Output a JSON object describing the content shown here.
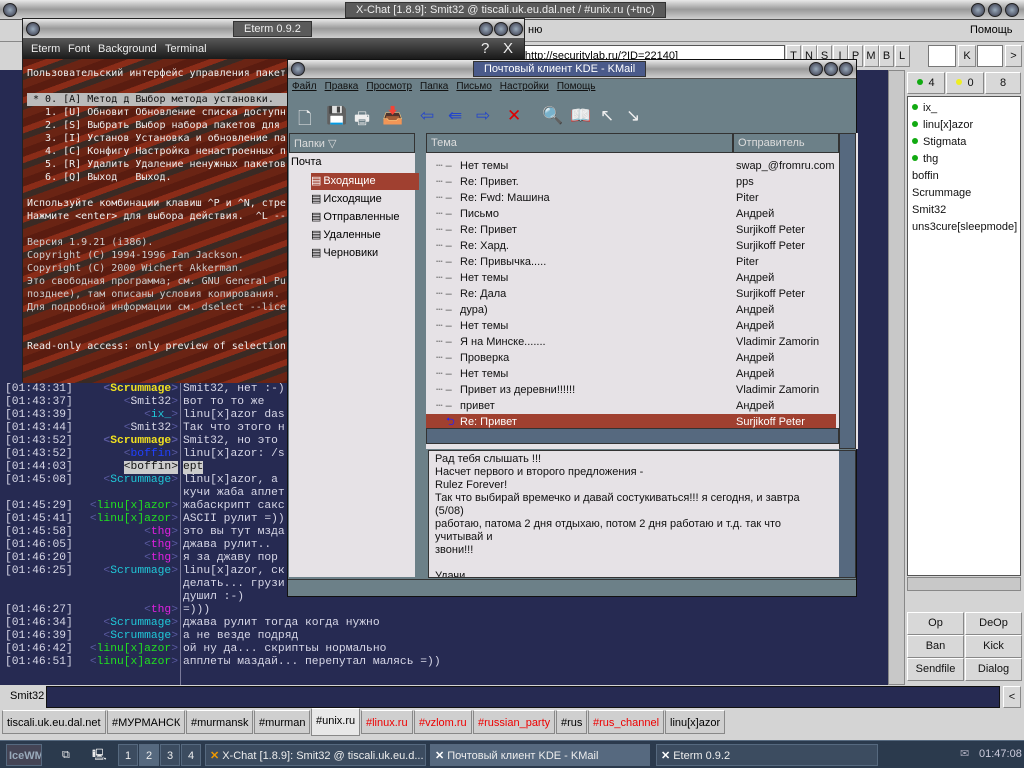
{
  "xchat": {
    "title": "X-Chat [1.8.9]: Smit32 @ tiscali.uk.eu.dal.net / #unix.ru (+tnc)",
    "menu_partial": "ню",
    "menu_help": "Помощь",
    "topic": "ru [http://securitylab.ru/?ID=22140]",
    "mode_buttons": [
      "T",
      "N",
      "S",
      "I",
      "P",
      "M",
      "B",
      "L"
    ],
    "key_label": "K",
    "next": ">",
    "prev": "<",
    "chat": [
      {
        "time": "[01:43:31]",
        "nick": "Scrummage",
        "color": "#f0e020",
        "bold": true,
        "text": [
          "Smit32, нет :-)"
        ]
      },
      {
        "time": "[01:43:37]",
        "nick": "Smit32",
        "color": "#d8d8e8",
        "text": [
          "вот то то же"
        ]
      },
      {
        "time": "[01:43:39]",
        "nick": "ix_",
        "color": "#20c8d8",
        "text": [
          "linu[x]azor das"
        ]
      },
      {
        "time": "[01:43:44]",
        "nick": "Smit32",
        "color": "#d8d8e8",
        "text": [
          "Так что этого н"
        ]
      },
      {
        "time": "[01:43:52]",
        "nick": "Scrummage",
        "color": "#f0e020",
        "bold": true,
        "text": [
          "Smit32, но это"
        ]
      },
      {
        "time": "[01:43:52]",
        "nick": "boffin",
        "color": "#2040ff",
        "text": [
          "linu[x]azor: /s"
        ]
      },
      {
        "time": "[01:44:03]",
        "nick": "boffin",
        "color": "#111",
        "hl": true,
        "text": [
          "ept"
        ]
      },
      {
        "time": "[01:45:08]",
        "nick": "Scrummage",
        "color": "#20c8d8",
        "text": [
          "linu[x]azor, а",
          "кучи жаба аплет"
        ]
      },
      {
        "time": "[01:45:29]",
        "nick": "linu[x]azor",
        "color": "#20e020",
        "text": [
          "жабаскрипт сакс"
        ]
      },
      {
        "time": "[01:45:41]",
        "nick": "linu[x]azor",
        "color": "#20e020",
        "text": [
          "ASCII рулит =))"
        ]
      },
      {
        "time": "[01:45:58]",
        "nick": "thg",
        "color": "#e020e0",
        "text": [
          "это вы тут мзда"
        ]
      },
      {
        "time": "[01:46:05]",
        "nick": "thg",
        "color": "#e020e0",
        "text": [
          "джава рулит.."
        ]
      },
      {
        "time": "[01:46:20]",
        "nick": "thg",
        "color": "#e020e0",
        "text": [
          "я за джаву пор"
        ]
      },
      {
        "time": "[01:46:25]",
        "nick": "Scrummage",
        "color": "#20c8d8",
        "text": [
          "linu[x]azor, ск",
          "делать... грузи",
          "душил :-)"
        ]
      },
      {
        "time": "[01:46:27]",
        "nick": "thg",
        "color": "#e020e0",
        "text": [
          "=)))"
        ]
      },
      {
        "time": "[01:46:34]",
        "nick": "Scrummage",
        "color": "#20c8d8",
        "text": [
          "джава рулит тогда когда нужно"
        ]
      },
      {
        "time": "[01:46:39]",
        "nick": "Scrummage",
        "color": "#20c8d8",
        "text": [
          "а не везде подряд"
        ]
      },
      {
        "time": "[01:46:42]",
        "nick": "linu[x]azor",
        "color": "#20e020",
        "text": [
          "ой ну да... скриптьы нормально"
        ]
      },
      {
        "time": "[01:46:51]",
        "nick": "linu[x]azor",
        "color": "#20e020",
        "text": [
          "апплеты маздай... перепутал малясь =))"
        ]
      }
    ],
    "counts": {
      "ops": "4",
      "voices": "0",
      "total": "8"
    },
    "users": [
      {
        "name": "ix_",
        "op": true
      },
      {
        "name": "linu[x]azor",
        "op": true
      },
      {
        "name": "Stigmata",
        "op": true
      },
      {
        "name": "thg",
        "op": true
      },
      {
        "name": "boffin"
      },
      {
        "name": "Scrummage"
      },
      {
        "name": "Smit32"
      },
      {
        "name": "uns3cure[sleepmode]"
      }
    ],
    "user_buttons": [
      "Op",
      "DeOp",
      "Ban",
      "Kick",
      "Sendfile",
      "Dialog"
    ],
    "nick": "Smit32",
    "tabs": [
      {
        "label": "tiscali.uk.eu.dal.net"
      },
      {
        "label": "#МУРМАНСК"
      },
      {
        "label": "#murmansk"
      },
      {
        "label": "#murman"
      },
      {
        "label": "#unix.ru",
        "active": true
      },
      {
        "label": "#linux.ru",
        "red": true
      },
      {
        "label": "#vzlom.ru",
        "red": true
      },
      {
        "label": "#russian_party",
        "red": true
      },
      {
        "label": "#rus"
      },
      {
        "label": "#rus_channel",
        "red": true
      },
      {
        "label": "linu[x]azor"
      }
    ]
  },
  "eterm": {
    "title": "Eterm 0.9.2",
    "menu": [
      "Eterm",
      "Font",
      "Background",
      "Terminal"
    ],
    "help": "?",
    "close": "X",
    "lines": [
      "Пользовательский интерфейс управления пакет",
      "",
      " * 0. [A] Метод д Выбор метода установки.",
      "   1. [U] Обновит Обновление списка доступн",
      "   2. [S] Выбрать Выбор набора пакетов для",
      "   3. [I] Установ Установка и обновление па",
      "   4. [C] Конфигу Настройка ненастроенных п",
      "   5. [R] Удалить Удаление ненужных пакетов",
      "   6. [Q] Выход   Выход.",
      "",
      "Используйте комбинации клавиш ^P и ^N, стре",
      "Нажмите <enter> для выбора действия.  ^L --",
      "",
      "Версия 1.9.21 (i386).",
      "Copyright (C) 1994-1996 Ian Jackson.",
      "Copyright (C) 2000 Wichert Akkerman.",
      "Это свободная программа; см. GNU General Pu",
      "позднее), там описаны условия копирования.",
      "Для подробной информации см. dselect --lice",
      "",
      "",
      "Read-only access: only preview of selection"
    ]
  },
  "kmail": {
    "title": "Почтовый клиент KDE - KMail",
    "menu": [
      "Файл",
      "Правка",
      "Просмотр",
      "Папка",
      "Письмо",
      "Настройки",
      "Помощь"
    ],
    "toolbar": [
      "new-message-icon",
      "save-icon",
      "print-icon",
      "check-mail-icon",
      "reply-icon",
      "reply-all-icon",
      "forward-icon",
      "delete-icon",
      "search-icon",
      "address-book-icon",
      "previous-icon",
      "next-icon"
    ],
    "folders_header": "Папки",
    "root": "Почта",
    "folders": [
      {
        "name": "Входящие",
        "icon": "inbox-icon",
        "selected": true
      },
      {
        "name": "Исходящие",
        "icon": "outbox-icon"
      },
      {
        "name": "Отправленные",
        "icon": "sent-icon"
      },
      {
        "name": "Удаленные",
        "icon": "trash-icon"
      },
      {
        "name": "Черновики",
        "icon": "drafts-icon"
      }
    ],
    "col_subject": "Тема",
    "col_sender": "Отправитель",
    "messages": [
      {
        "subject": "Нет темы",
        "from": "swap_@fromru.com"
      },
      {
        "subject": "Re: Привет.",
        "from": "pps"
      },
      {
        "subject": "Re: Fwd: Машина",
        "from": "Piter"
      },
      {
        "subject": "Письмо",
        "from": "Андрей"
      },
      {
        "subject": "Re: Привет",
        "from": "Surjikoff Peter"
      },
      {
        "subject": "Re: Хард.",
        "from": "Surjikoff Peter"
      },
      {
        "subject": "Re: Привычка.....",
        "from": "Piter"
      },
      {
        "subject": "Нет темы",
        "from": "Андрей"
      },
      {
        "subject": "Re: Дала",
        "from": "Surjikoff Peter"
      },
      {
        "subject": "дура)",
        "from": "Андрей"
      },
      {
        "subject": "Нет темы",
        "from": "Андрей"
      },
      {
        "subject": "Я на Минске.......",
        "from": "Vladimir Zamorin"
      },
      {
        "subject": "Проверка",
        "from": "Андрей"
      },
      {
        "subject": "Нет темы",
        "from": "Андрей"
      },
      {
        "subject": "Привет из деревни!!!!!!",
        "from": "Vladimir Zamorin"
      },
      {
        "subject": "привет",
        "from": "Андрей"
      },
      {
        "subject": "Re: Привет",
        "from": "Surjikoff Peter",
        "selected": true
      }
    ],
    "body": [
      "Рад тебя слышать !!!",
      "Насчет первого и второго предложения -",
      "Rulez Forever!",
      "Так что выбирай времечко и давай состукиваться!!! я сегодня, и завтра",
      "(5/08)",
      "работаю, патома 2 дня отдыхаю, потом 2 дня работаю и т.д. так что",
      "учитывай и",
      "звони!!!",
      "",
      "Удачи"
    ]
  },
  "taskbar": {
    "start": "IceWM",
    "workspaces": [
      "1",
      "2",
      "3",
      "4"
    ],
    "active_ws": "2",
    "tasks": [
      "X-Chat [1.8.9]: Smit32 @ tiscali.uk.eu.d...",
      "Почтовый клиент KDE - KMail",
      "Eterm 0.9.2"
    ],
    "clock": "01:47:08"
  },
  "colors": {
    "chat_bg": "#262a52",
    "kmail_chrome": "#6c8088",
    "selection": "#a04030",
    "taskbar": "#2b3a4d"
  }
}
